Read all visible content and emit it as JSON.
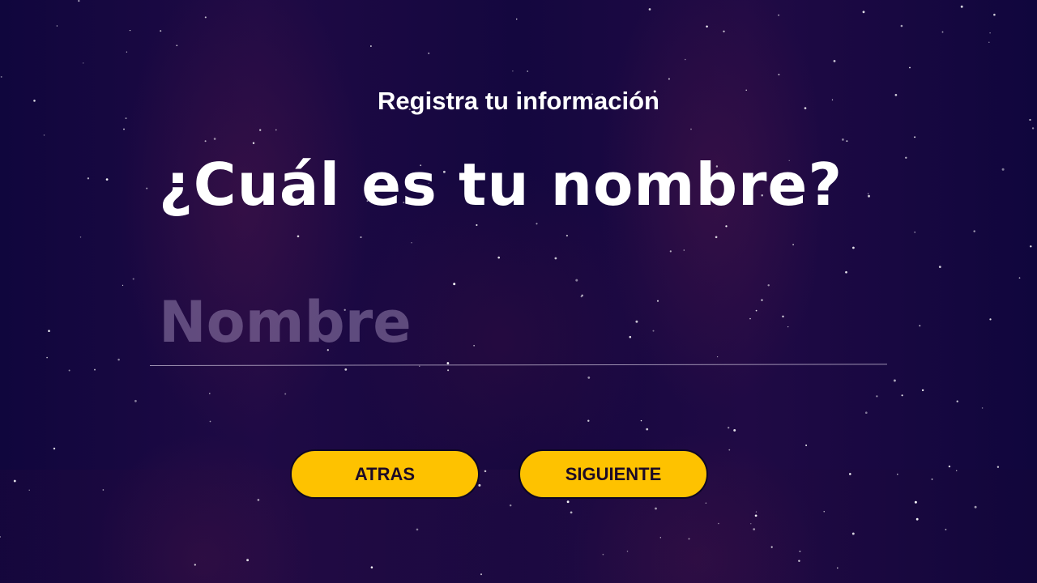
{
  "header": {
    "subtitle": "Registra tu información"
  },
  "main": {
    "question": "¿Cuál es tu nombre?",
    "name_input": {
      "placeholder": "Nombre",
      "value": ""
    }
  },
  "actions": {
    "back_label": "ATRAS",
    "next_label": "SIGUIENTE"
  },
  "colors": {
    "background": "#140640",
    "button": "#fec200",
    "button_text": "#1c0a26",
    "text": "#ffffff"
  }
}
